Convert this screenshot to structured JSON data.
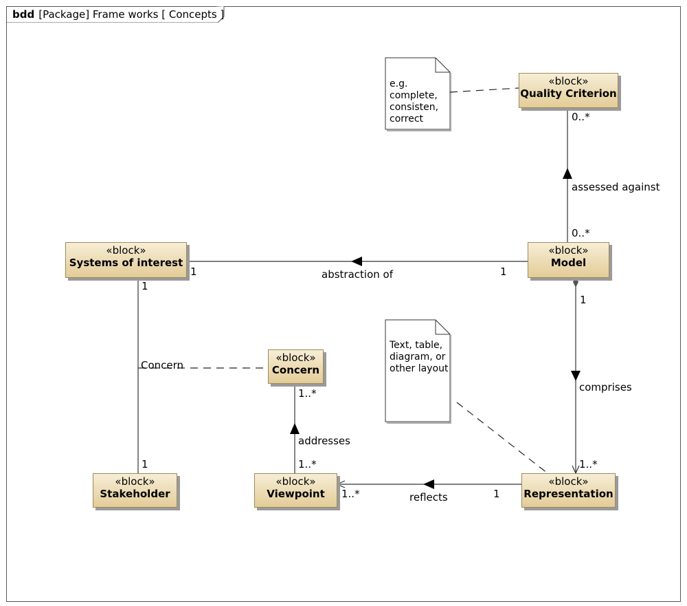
{
  "frame": {
    "kind": "bdd",
    "title": "[Package] Frame works [ Concepts ]"
  },
  "stereotype": "«block»",
  "blocks": {
    "quality": "Quality Criterion",
    "systems": "Systems of interest",
    "model": "Model",
    "concern": "Concern",
    "stakeholder": "Stakeholder",
    "viewpoint": "Viewpoint",
    "representation": "Representation"
  },
  "notes": {
    "quality": [
      "e.g.",
      "complete,",
      "consisten,",
      "correct"
    ],
    "representation": [
      "Text, table,",
      "diagram, or",
      "other layout"
    ]
  },
  "labels": {
    "assessed_against": "assessed against",
    "abstraction_of": "abstraction of",
    "comprises": "comprises",
    "addresses": "addresses",
    "reflects": "reflects",
    "concern_assoc": "Concern"
  },
  "multiplicities": {
    "quality_end": "0..*",
    "model_quality_end": "0..*",
    "systems_end": "1",
    "model_abstraction_end": "1",
    "model_composite_end": "1",
    "representation_end": "1..*",
    "systems_stake_end": "1",
    "stakeholder_end": "1",
    "concern_end": "1..*",
    "viewpoint_addresses_end": "1..*",
    "viewpoint_end": "1..*",
    "representation_reflects_end": "1"
  }
}
